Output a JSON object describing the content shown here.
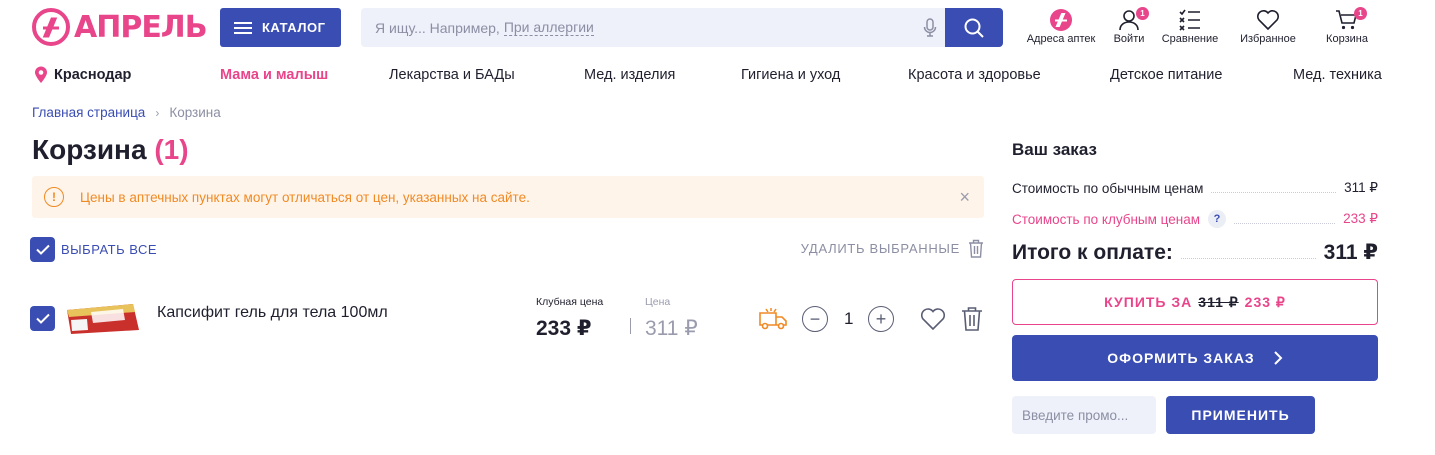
{
  "header": {
    "logo_text": "АПРЕЛЬ",
    "catalog_label": "КАТАЛОГ",
    "search_placeholder_prefix": "Я ищу... Например,",
    "search_placeholder_link": "При аллергии",
    "nav": [
      {
        "label": "Адреса аптек",
        "icon": "pharmacy-logo-icon"
      },
      {
        "label": "Войти",
        "icon": "user-icon",
        "badge": "1"
      },
      {
        "label": "Сравнение",
        "icon": "compare-icon"
      },
      {
        "label": "Избранное",
        "icon": "heart-icon"
      },
      {
        "label": "Корзина",
        "icon": "cart-icon",
        "badge": "1"
      }
    ]
  },
  "categories": {
    "city": "Краснодар",
    "items": [
      "Мама и малыш",
      "Лекарства и БАДы",
      "Мед. изделия",
      "Гигиена и уход",
      "Красота и здоровье",
      "Детское питание",
      "Мед. техника"
    ]
  },
  "breadcrumb": {
    "home": "Главная страница",
    "current": "Корзина"
  },
  "page": {
    "title": "Корзина",
    "count": "(1)"
  },
  "notice": {
    "text": "Цены в аптечных пунктах могут отличаться от цен, указанных на сайте."
  },
  "cart": {
    "select_all_label": "ВЫБРАТЬ ВСЕ",
    "delete_selected_label": "УДАЛИТЬ ВЫБРАННЫЕ",
    "items": [
      {
        "name": "Капсифит гель для тела 100мл",
        "club_price_label": "Клубная цена",
        "club_price": "233 ₽",
        "price_label": "Цена",
        "price": "311 ₽",
        "quantity": "1"
      }
    ]
  },
  "summary": {
    "title": "Ваш заказ",
    "regular_label": "Стоимость по обычным ценам",
    "regular_value": "311 ₽",
    "club_label": "Стоимость по клубным ценам",
    "club_help": "?",
    "club_value": "233 ₽",
    "total_label": "Итого к оплате:",
    "total_value": "311 ₽",
    "buy_prefix": "КУПИТЬ ЗА",
    "buy_old": "311 ₽",
    "buy_new": "233 ₽",
    "checkout_label": "ОФОРМИТЬ ЗАКАЗ",
    "promo_placeholder": "Введите промо...",
    "apply_label": "ПРИМЕНИТЬ"
  },
  "colors": {
    "brand_pink": "#e8458b",
    "brand_blue": "#3a4db3",
    "notice_orange": "#f08a24"
  }
}
